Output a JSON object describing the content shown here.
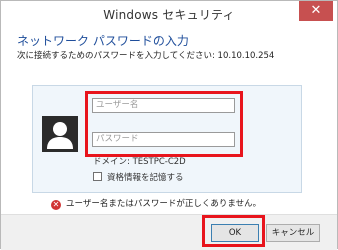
{
  "window": {
    "title": "Windows セキュリティ",
    "close_glyph": "✕"
  },
  "dialog": {
    "heading": "ネットワーク パスワードの入力",
    "subheading": "次に接続するためのパスワードを入力してください: 10.10.10.254"
  },
  "credentials": {
    "avatar_icon": "user-avatar-icon",
    "username_placeholder": "ユーザー名",
    "password_placeholder": "パスワード",
    "domain_text": "ドメイン: TESTPC-C2D",
    "remember_label": "資格情報を記憶する",
    "remember_checked": false
  },
  "error": {
    "icon": "error-icon",
    "glyph": "✕",
    "message": "ユーザー名またはパスワードが正しくありません。"
  },
  "buttons": {
    "ok_label": "OK",
    "cancel_label": "キャンセル"
  },
  "colors": {
    "highlight": "#e8141c",
    "close_button": "#c75050",
    "heading": "#1f4e9b",
    "error": "#d03434"
  }
}
